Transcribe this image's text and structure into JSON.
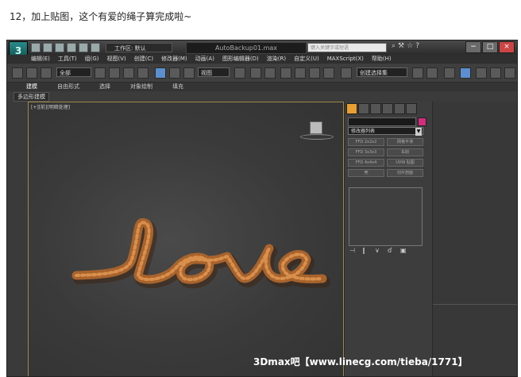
{
  "caption": "12，加上贴图，这个有爱的绳子算完成啦~",
  "window": {
    "title": "AutoBackup01.max",
    "logo": "3",
    "workspace_label": "工作区: 默认",
    "search_placeholder": "键入关键字或短语",
    "title_tools": [
      "⌕",
      "⚒",
      "☆",
      "?"
    ],
    "buttons": [
      "−",
      "□",
      "×"
    ]
  },
  "menu": [
    "编辑(E)",
    "工具(T)",
    "组(G)",
    "视图(V)",
    "创建(C)",
    "修改器(M)",
    "动画(A)",
    "图形编辑器(D)",
    "渲染(R)",
    "自定义(U)",
    "MAXScript(X)",
    "帮助(H)"
  ],
  "toolbar": {
    "selection_filter": "全部",
    "view_dropdown": "视图",
    "named_set": "创建选择集"
  },
  "ribbon": {
    "tabs": [
      "建模",
      "自由形式",
      "选择",
      "对象绘制",
      "填充"
    ],
    "sub_label": "多边形建模"
  },
  "viewport": {
    "label": "[+][前][明暗处理]",
    "watermark": "3Dmax吧【www.linecg.com/tieba/1771】",
    "rope_color": "#a8632c",
    "rope_highlight": "#d9904d"
  },
  "command_panel": {
    "modifier_list": "修改器列表",
    "object_color": "#d42c7c",
    "buttons": [
      "FFD 2x2x2",
      "网格平滑",
      "FFD 3x3x3",
      "车削",
      "FFD 4x4x4",
      "UVW 贴图",
      "壳",
      "切片剖面"
    ]
  },
  "icons": {
    "tabs": [
      "create-icon",
      "modify-icon",
      "hierarchy-icon",
      "motion-icon",
      "display-icon",
      "utilities-icon"
    ],
    "stack": [
      "pin-stack-icon",
      "show-end-result-icon",
      "make-unique-icon",
      "remove-modifier-icon",
      "configure-sets-icon"
    ]
  }
}
